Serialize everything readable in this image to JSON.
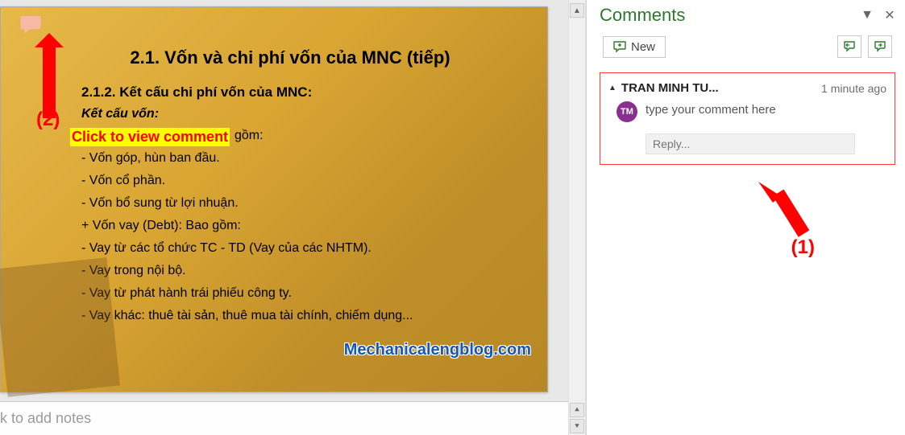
{
  "slide": {
    "title": "2.1. Vốn và chi phí vốn của MNC (tiếp)",
    "sub1": "2.1.2. Kết cấu chi phí vốn của MNC:",
    "sub2": "Kết cấu vốn:",
    "lines": [
      "gồm:",
      "- Vốn góp, hùn ban đầu.",
      "- Vốn cổ phần.",
      "- Vốn bổ sung từ lợi nhuận.",
      "+ Vốn vay (Debt): Bao gồm:",
      "- Vay từ các tổ chức TC - TD (Vay của các NHTM).",
      "- Vay trong nội bộ.",
      "- Vay từ phát hành trái phiếu công ty.",
      "- Vay khác: thuê tài sản, thuê mua tài chính, chiếm dụng..."
    ],
    "highlight": "Click to view comment",
    "watermark": "Mechanicalengblog.com"
  },
  "annotations": {
    "label1": "(1)",
    "label2": "(2)"
  },
  "notes": {
    "placeholder": "k to add notes"
  },
  "commentsPanel": {
    "title": "Comments",
    "newLabel": "New",
    "card": {
      "author": "TRAN MINH TU...",
      "time": "1 minute ago",
      "avatarInitials": "TM",
      "text": "type your comment here",
      "replyPlaceholder": "Reply..."
    }
  }
}
